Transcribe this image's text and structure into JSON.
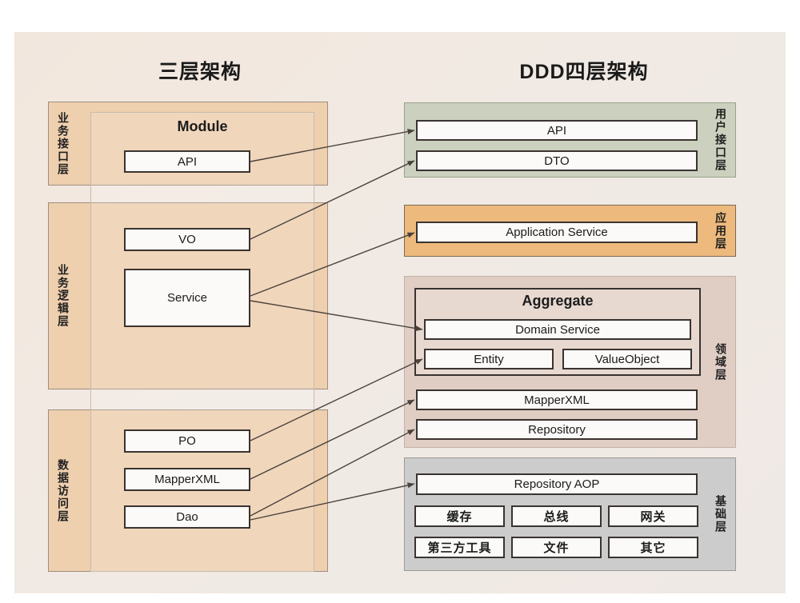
{
  "titles": {
    "left": "三层架构",
    "right": "DDD四层架构"
  },
  "colors": {
    "canvas_bg": "#f1eae4",
    "left_layer": "#eecfae",
    "ui_layer": "#ccd1bf",
    "app_layer": "#eeb97d",
    "domain_layer": "#e0cec5",
    "infra_layer": "#cccccc",
    "item_bg": "#fbfaf8",
    "item_border": "#3a3330",
    "arrow": "#4a423d"
  },
  "left": {
    "container_label": "Module",
    "layers": [
      {
        "label": "业务接口层",
        "items": [
          {
            "label": "API"
          }
        ]
      },
      {
        "label": "业务逻辑层",
        "items": [
          {
            "label": "VO"
          },
          {
            "label": "Service"
          }
        ]
      },
      {
        "label": "数据访问层",
        "items": [
          {
            "label": "PO"
          },
          {
            "label": "MapperXML"
          },
          {
            "label": "Dao"
          }
        ]
      }
    ]
  },
  "right": {
    "aggregate_label": "Aggregate",
    "layers": [
      {
        "label": "用户接口层",
        "items": [
          {
            "label": "API"
          },
          {
            "label": "DTO"
          }
        ]
      },
      {
        "label": "应用层",
        "items": [
          {
            "label": "Application Service"
          }
        ]
      },
      {
        "label": "领域层",
        "items": [
          {
            "label": "Domain Service"
          },
          {
            "label": "Entity"
          },
          {
            "label": "ValueObject"
          },
          {
            "label": "MapperXML"
          },
          {
            "label": "Repository"
          }
        ]
      },
      {
        "label": "基础层",
        "items": [
          {
            "label": "Repository AOP"
          },
          {
            "label": "缓存"
          },
          {
            "label": "总线"
          },
          {
            "label": "网关"
          },
          {
            "label": "第三方工具"
          },
          {
            "label": "文件"
          },
          {
            "label": "其它"
          }
        ]
      }
    ]
  },
  "mappings": [
    {
      "from": "API",
      "to": "API"
    },
    {
      "from": "VO",
      "to": "DTO"
    },
    {
      "from": "Service",
      "to": "Application Service"
    },
    {
      "from": "Service",
      "to": "Domain Service"
    },
    {
      "from": "PO",
      "to": "Entity"
    },
    {
      "from": "MapperXML",
      "to": "MapperXML"
    },
    {
      "from": "Dao",
      "to": "Repository"
    },
    {
      "from": "Dao",
      "to": "Repository AOP"
    }
  ]
}
